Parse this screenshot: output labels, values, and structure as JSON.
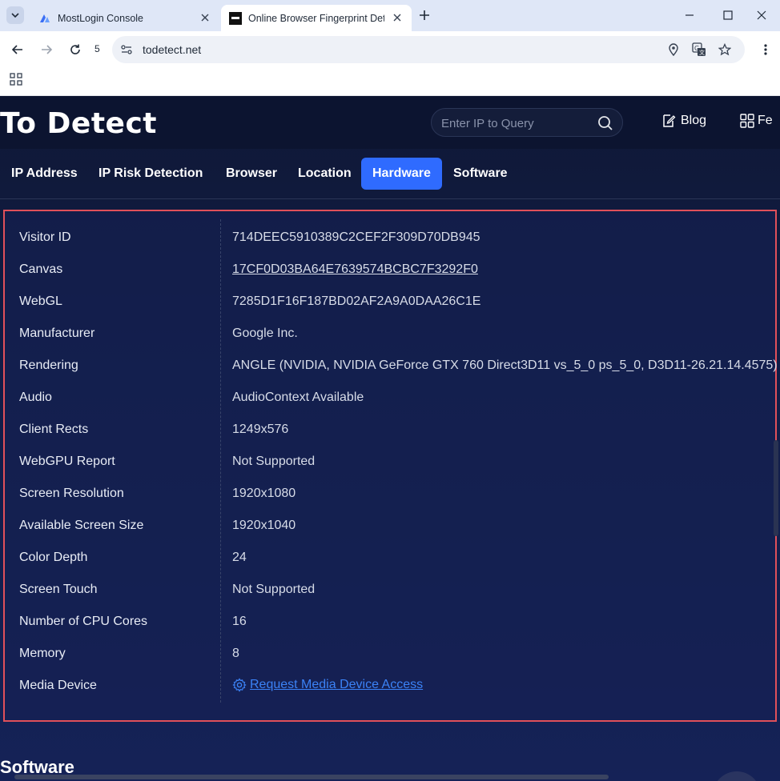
{
  "browser": {
    "tabs": [
      {
        "title": "MostLogin Console"
      },
      {
        "title": "Online Browser Fingerprint Dete"
      }
    ],
    "tab_count": "5",
    "url": "todetect.net"
  },
  "site": {
    "logo": "To Detect",
    "search_placeholder": "Enter IP to Query",
    "blog_label": "Blog",
    "fe_label": "Fe"
  },
  "nav": {
    "tabs": [
      {
        "label": "IP Address"
      },
      {
        "label": "IP Risk Detection"
      },
      {
        "label": "Browser"
      },
      {
        "label": "Location"
      },
      {
        "label": "Hardware"
      },
      {
        "label": "Software"
      }
    ],
    "active": "Hardware"
  },
  "hardware": {
    "rows": [
      {
        "label": "Visitor ID",
        "value": "714DEEC5910389C2CEF2F309D70DB945"
      },
      {
        "label": "Canvas",
        "value": "17CF0D03BA64E7639574BCBC7F3292F0"
      },
      {
        "label": "WebGL",
        "value": "7285D1F16F187BD02AF2A9A0DAA26C1E"
      },
      {
        "label": "Manufacturer",
        "value": "Google Inc."
      },
      {
        "label": "Rendering",
        "value": "ANGLE (NVIDIA, NVIDIA GeForce GTX 760 Direct3D11 vs_5_0 ps_5_0, D3D11-26.21.14.4575)"
      },
      {
        "label": "Audio",
        "value": "AudioContext Available"
      },
      {
        "label": "Client Rects",
        "value": "1249x576"
      },
      {
        "label": "WebGPU Report",
        "value": "Not Supported"
      },
      {
        "label": "Screen Resolution",
        "value": "1920x1080"
      },
      {
        "label": "Available Screen Size",
        "value": "1920x1040"
      },
      {
        "label": "Color Depth",
        "value": "24"
      },
      {
        "label": "Screen Touch",
        "value": "Not Supported"
      },
      {
        "label": "Number of CPU Cores",
        "value": "16"
      },
      {
        "label": "Memory",
        "value": "8"
      },
      {
        "label": "Media Device",
        "value": "Request Media Device Access"
      }
    ]
  },
  "next_section": "Software",
  "colors": {
    "accent": "#2f6bff",
    "highlight_border": "#e0505a",
    "link": "#3b82f6"
  }
}
